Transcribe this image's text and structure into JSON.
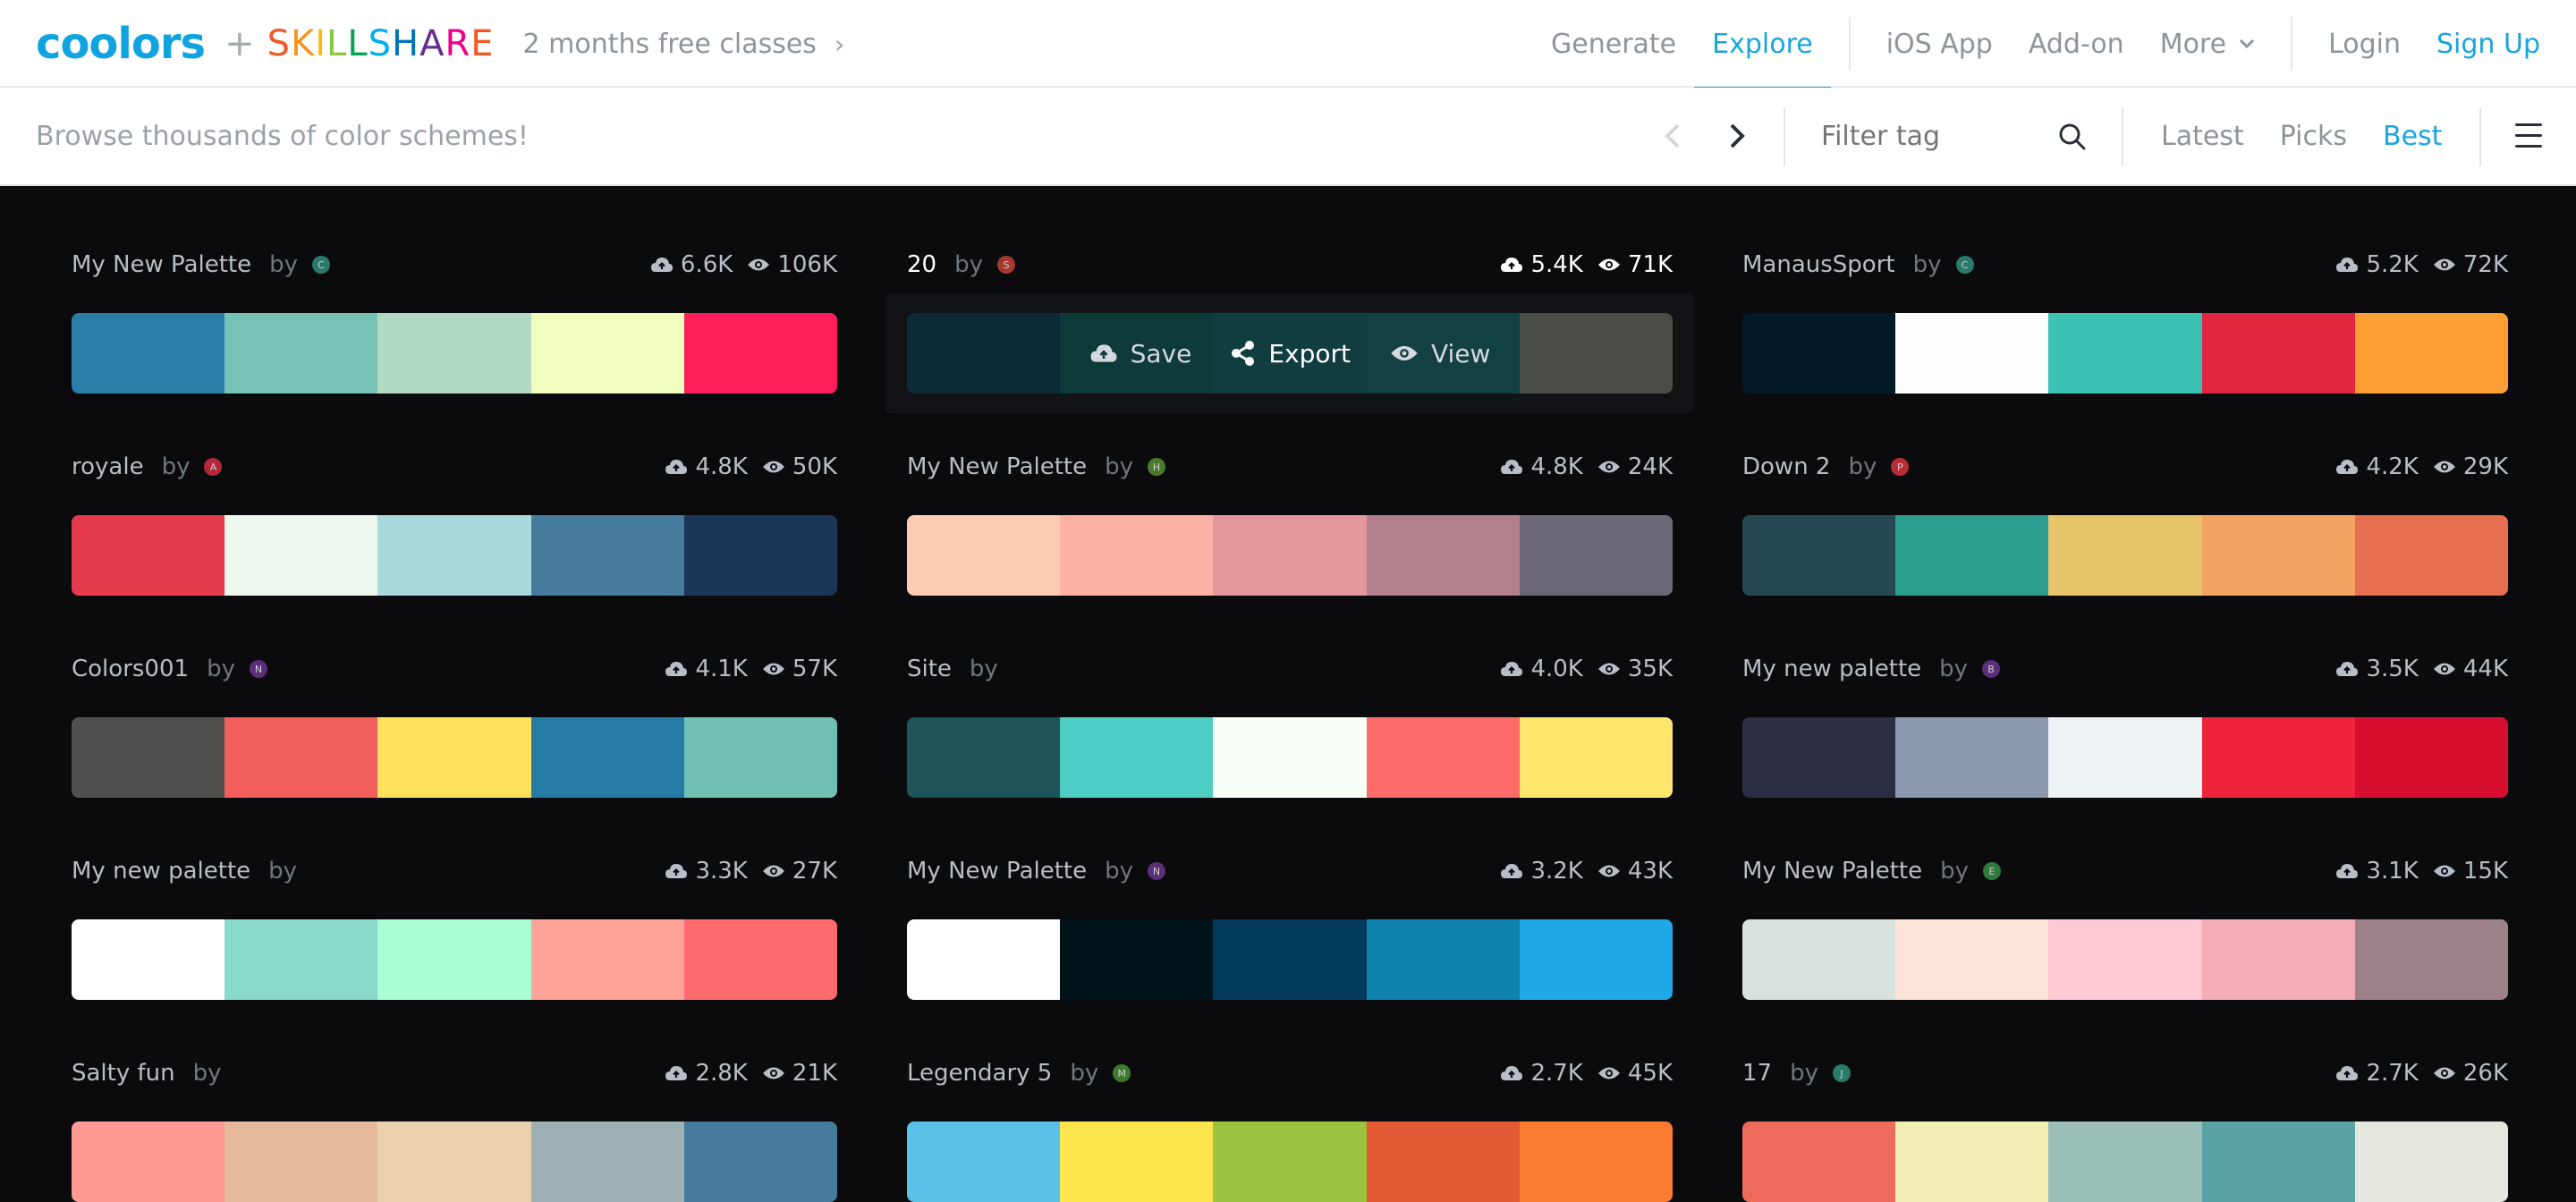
{
  "nav": {
    "logo": "coolors",
    "plus": "+",
    "skillshare": [
      "S",
      "K",
      "I",
      "L",
      "L",
      "S",
      "H",
      "A",
      "R",
      "E"
    ],
    "skillshare_colors": [
      "#f05a28",
      "#f7941d",
      "#fdb913",
      "#8dc63f",
      "#00a651",
      "#00aeef",
      "#0072bc",
      "#662d91",
      "#ec008c",
      "#f05a28"
    ],
    "promo": "2 months free classes",
    "links": [
      "Generate",
      "Explore",
      "iOS App",
      "Add-on",
      "More",
      "Login",
      "Sign Up"
    ]
  },
  "subbar": {
    "browse_text": "Browse thousands of color schemes!",
    "filter_placeholder": "Filter tag",
    "sorts": [
      "Latest",
      "Picks",
      "Best"
    ]
  },
  "overlay": {
    "save": "Save",
    "export": "Export",
    "view": "View"
  },
  "palettes": [
    {
      "name": "My New Palette",
      "by": "by",
      "avatar_color": "#2a7a6a",
      "avatar_letter": "C",
      "saves": "6.6K",
      "views": "106K",
      "colors": [
        "#2a7ea8",
        "#76c3b6",
        "#b2dac3",
        "#f1fdbe",
        "#fe1e5a"
      ]
    },
    {
      "name": "20",
      "by": "by",
      "avatar_color": "#a5392e",
      "avatar_letter": "S",
      "saves": "5.4K",
      "views": "71K",
      "colors": [
        "#0c2a38",
        "#0f3a3a",
        "#123d40",
        "#134042",
        "#4a4d45"
      ],
      "hover": true
    },
    {
      "name": "ManausSport",
      "by": "by",
      "avatar_color": "#2a7a6a",
      "avatar_letter": "C",
      "saves": "5.2K",
      "views": "72K",
      "colors": [
        "#041928",
        "#fdfefc",
        "#3bc2b5",
        "#e42540",
        "#fd9e35"
      ]
    },
    {
      "name": "royale",
      "by": "by",
      "avatar_color": "#b3273a",
      "avatar_letter": "A",
      "saves": "4.8K",
      "views": "50K",
      "colors": [
        "#e53a4d",
        "#eef7ee",
        "#a7d9dd",
        "#457b9d",
        "#1d3557"
      ]
    },
    {
      "name": "My New Palette",
      "by": "by",
      "avatar_color": "#4b7a2e",
      "avatar_letter": "H",
      "saves": "4.8K",
      "views": "24K",
      "colors": [
        "#ffcbb2",
        "#feb2a7",
        "#e4989c",
        "#b47f8d",
        "#6d6877"
      ]
    },
    {
      "name": "Down 2",
      "by": "by",
      "avatar_color": "#b82c38",
      "avatar_letter": "P",
      "saves": "4.2K",
      "views": "29K",
      "colors": [
        "#274754",
        "#2a9d8f",
        "#e8c46a",
        "#f3a462",
        "#e76f51"
      ]
    },
    {
      "name": "Colors001",
      "by": "by",
      "avatar_color": "#5a2e78",
      "avatar_letter": "N",
      "saves": "4.1K",
      "views": "57K",
      "colors": [
        "#50514f",
        "#f15e5b",
        "#ffe15c",
        "#257ba3",
        "#70c1b3"
      ]
    },
    {
      "name": "Site",
      "by": "by",
      "avatar_color": "",
      "avatar_letter": "",
      "saves": "4.0K",
      "views": "35K",
      "colors": [
        "#1e5358",
        "#4ecdc4",
        "#f7fff7",
        "#ff6b6b",
        "#ffe66d"
      ]
    },
    {
      "name": "My new palette",
      "by": "by",
      "avatar_color": "#5a2e78",
      "avatar_letter": "B",
      "saves": "3.5K",
      "views": "44K",
      "colors": [
        "#2b2d42",
        "#8d99ae",
        "#edf2f4",
        "#ef233c",
        "#d80e31"
      ]
    },
    {
      "name": "My new palette",
      "by": "by",
      "avatar_color": "",
      "avatar_letter": "",
      "saves": "3.3K",
      "views": "27K",
      "colors": [
        "#ffffff",
        "#88dac8",
        "#a8ffd4",
        "#ffa39b",
        "#ff6b6f"
      ]
    },
    {
      "name": "My New Palette",
      "by": "by",
      "avatar_color": "#5a2e78",
      "avatar_letter": "N",
      "saves": "3.2K",
      "views": "43K",
      "colors": [
        "#ffffff",
        "#001419",
        "#023a5d",
        "#0f82ad",
        "#1fa9e6"
      ]
    },
    {
      "name": "My New Palette",
      "by": "by",
      "avatar_color": "#2e7a3e",
      "avatar_letter": "E",
      "saves": "3.1K",
      "views": "15K",
      "colors": [
        "#d8e2dc",
        "#ffe5d9",
        "#ffcad4",
        "#f4acb7",
        "#9d8189"
      ]
    },
    {
      "name": "Salty fun",
      "by": "by",
      "avatar_color": "",
      "avatar_letter": "",
      "saves": "2.8K",
      "views": "21K",
      "colors": [
        "#ff9a94",
        "#e6b99c",
        "#e9d1ae",
        "#9fb0b5",
        "#457b9c"
      ]
    },
    {
      "name": "Legendary 5",
      "by": "by",
      "avatar_color": "#3d7a2e",
      "avatar_letter": "M",
      "saves": "2.7K",
      "views": "45K",
      "colors": [
        "#5bc1e9",
        "#fde64d",
        "#9bc340",
        "#e35933",
        "#fb7b31"
      ]
    },
    {
      "name": "17",
      "by": "by",
      "avatar_color": "#2a7a6a",
      "avatar_letter": "J",
      "saves": "2.7K",
      "views": "26K",
      "colors": [
        "#ee6b5c",
        "#f2eeb4",
        "#9bbfb7",
        "#59a3a5",
        "#e5e8de"
      ]
    }
  ]
}
